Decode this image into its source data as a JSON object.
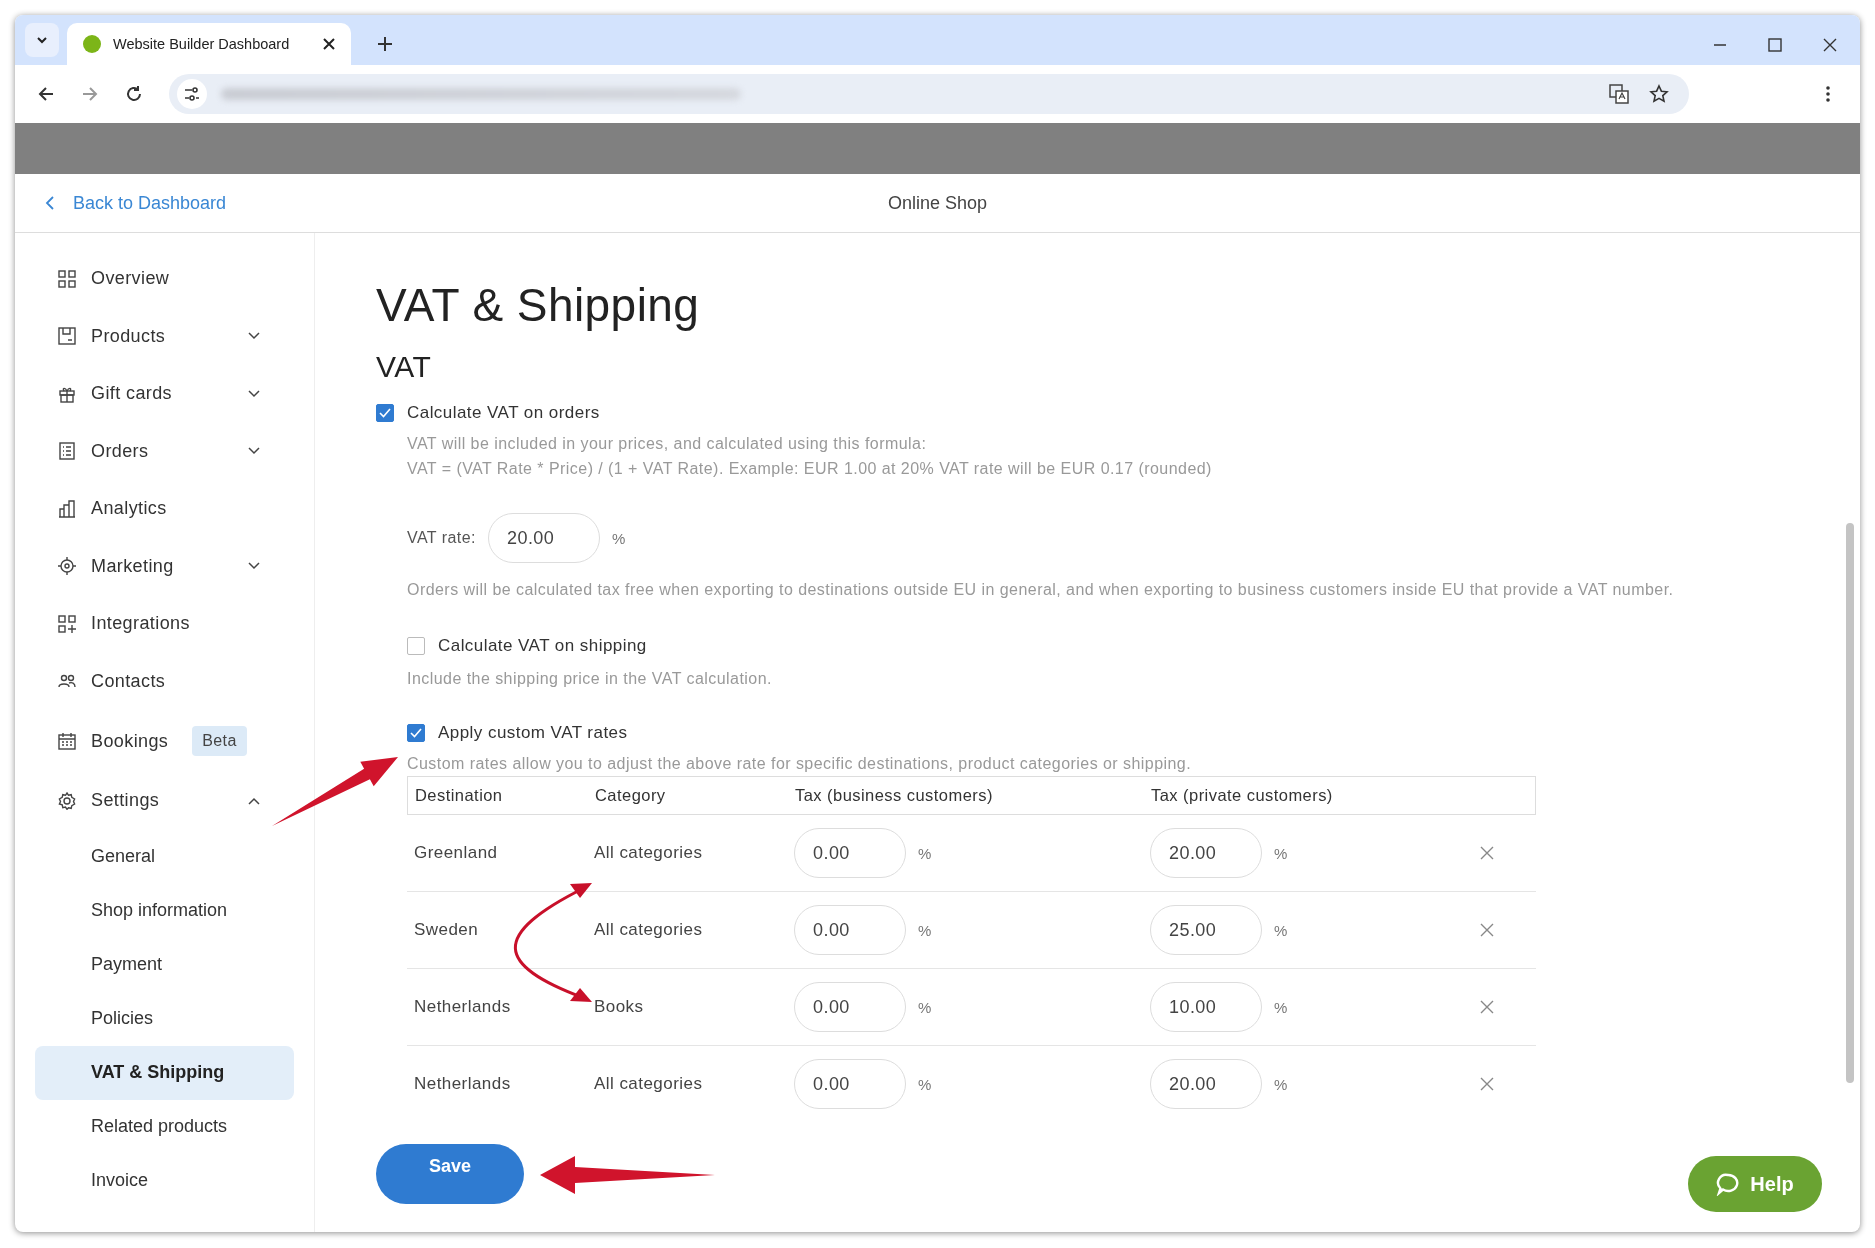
{
  "browser": {
    "tab_title": "Website Builder Dashboard"
  },
  "header": {
    "back_link": "Back to Dashboard",
    "title": "Online Shop"
  },
  "sidebar": {
    "items": [
      {
        "label": "Overview"
      },
      {
        "label": "Products",
        "expanded": false
      },
      {
        "label": "Gift cards",
        "expanded": false
      },
      {
        "label": "Orders",
        "expanded": false
      },
      {
        "label": "Analytics"
      },
      {
        "label": "Marketing",
        "expanded": false
      },
      {
        "label": "Integrations"
      },
      {
        "label": "Contacts"
      },
      {
        "label": "Bookings",
        "badge": "Beta"
      },
      {
        "label": "Settings",
        "expanded": true,
        "children": [
          {
            "label": "General",
            "selected": false
          },
          {
            "label": "Shop information",
            "selected": false
          },
          {
            "label": "Payment",
            "selected": false
          },
          {
            "label": "Policies",
            "selected": false
          },
          {
            "label": "VAT & Shipping",
            "selected": true
          },
          {
            "label": "Related products",
            "selected": false
          },
          {
            "label": "Invoice",
            "selected": false
          }
        ]
      }
    ]
  },
  "main": {
    "title": "VAT & Shipping",
    "section": "VAT",
    "vat_orders": {
      "label": "Calculate VAT on orders",
      "checked": true,
      "description": [
        "VAT will be included in your prices, and calculated using this formula:",
        "VAT = (VAT Rate * Price) / (1 + VAT Rate). Example: EUR 1.00 at 20% VAT rate will be EUR 0.17 (rounded)"
      ]
    },
    "vat_rate": {
      "label": "VAT rate:",
      "value": "20.00",
      "unit": "%"
    },
    "export_note": "Orders will be calculated tax free when exporting to destinations outside EU in general, and when exporting to business customers inside EU that provide a VAT number.",
    "vat_shipping": {
      "label": "Calculate VAT on shipping",
      "checked": false,
      "description": "Include the shipping price in the VAT calculation."
    },
    "custom_rates": {
      "label": "Apply custom VAT rates",
      "checked": true,
      "description": "Custom rates allow you to adjust the above rate for specific destinations, product categories or shipping."
    },
    "table": {
      "columns": [
        "Destination",
        "Category",
        "Tax (business customers)",
        "Tax (private customers)"
      ],
      "rows": [
        {
          "destination": "Greenland",
          "category": "All categories",
          "business_tax": "0.00",
          "business_unit": "%",
          "private_tax": "20.00",
          "private_unit": "%"
        },
        {
          "destination": "Sweden",
          "category": "All categories",
          "business_tax": "0.00",
          "business_unit": "%",
          "private_tax": "25.00",
          "private_unit": "%"
        },
        {
          "destination": "Netherlands",
          "category": "Books",
          "business_tax": "0.00",
          "business_unit": "%",
          "private_tax": "10.00",
          "private_unit": "%"
        },
        {
          "destination": "Netherlands",
          "category": "All categories",
          "business_tax": "0.00",
          "business_unit": "%",
          "private_tax": "20.00",
          "private_unit": "%"
        }
      ]
    },
    "save_button": "Save"
  },
  "help_button": "Help"
}
